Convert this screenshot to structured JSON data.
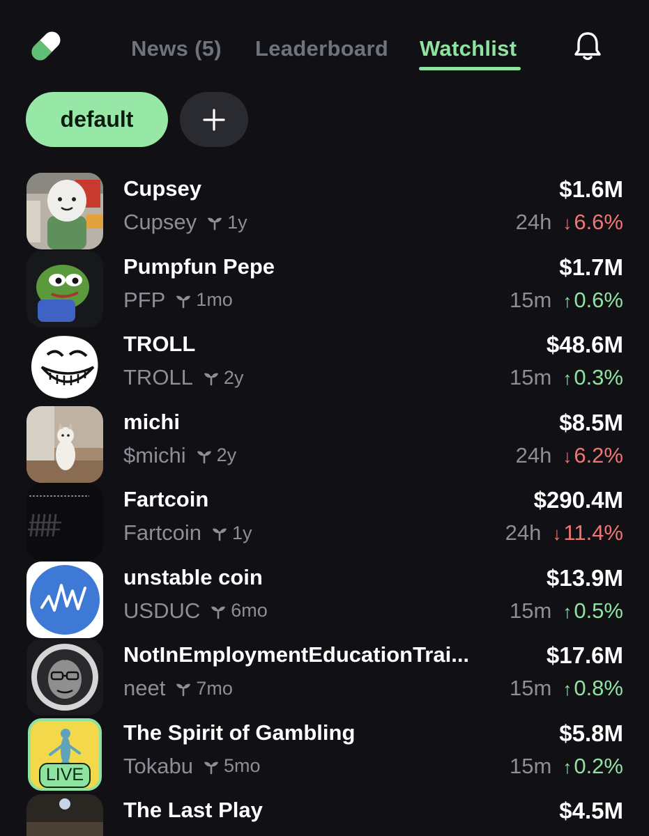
{
  "header": {
    "tabs": [
      {
        "label": "News (5)",
        "active": false
      },
      {
        "label": "Leaderboard",
        "active": false
      },
      {
        "label": "Watchlist",
        "active": true
      }
    ],
    "logo_icon": "pill-icon",
    "bell_icon": "bell-icon"
  },
  "watchlists": {
    "selected": "default",
    "add_icon": "plus-icon"
  },
  "colors": {
    "background": "#101015",
    "accent": "#8ee3a0",
    "negative": "#ef7672",
    "muted": "#8c8f97"
  },
  "tokens": [
    {
      "name": "Cupsey",
      "symbol": "Cupsey",
      "age": "1y",
      "mcap": "$1.6M",
      "period": "24h",
      "direction": "down",
      "change": "6.6%"
    },
    {
      "name": "Pumpfun Pepe",
      "symbol": "PFP",
      "age": "1mo",
      "mcap": "$1.7M",
      "period": "15m",
      "direction": "up",
      "change": "0.6%"
    },
    {
      "name": "TROLL",
      "symbol": "TROLL",
      "age": "2y",
      "mcap": "$48.6M",
      "period": "15m",
      "direction": "up",
      "change": "0.3%"
    },
    {
      "name": "michi",
      "symbol": "$michi",
      "age": "2y",
      "mcap": "$8.5M",
      "period": "24h",
      "direction": "down",
      "change": "6.2%"
    },
    {
      "name": "Fartcoin",
      "symbol": "Fartcoin",
      "age": "1y",
      "mcap": "$290.4M",
      "period": "24h",
      "direction": "down",
      "change": "11.4%"
    },
    {
      "name": "unstable coin",
      "symbol": "USDUC",
      "age": "6mo",
      "mcap": "$13.9M",
      "period": "15m",
      "direction": "up",
      "change": "0.5%"
    },
    {
      "name": "NotInEmploymentEducationTrai...",
      "symbol": "neet",
      "age": "7mo",
      "mcap": "$17.6M",
      "period": "15m",
      "direction": "up",
      "change": "0.8%"
    },
    {
      "name": "The Spirit of Gambling",
      "symbol": "Tokabu",
      "age": "5mo",
      "mcap": "$5.8M",
      "period": "15m",
      "direction": "up",
      "change": "0.2%",
      "badge": "LIVE"
    },
    {
      "name": "The Last Play",
      "symbol": "",
      "age": "",
      "mcap": "$4.5M",
      "period": "",
      "direction": "down",
      "change": ""
    }
  ]
}
